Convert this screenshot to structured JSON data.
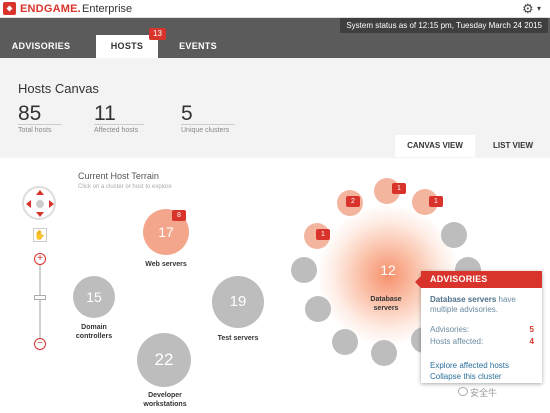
{
  "app": {
    "brand": "ENDGAME.",
    "edition": "Enterprise"
  },
  "status": "System status as of 12:15 pm, Tuesday March 24 2015",
  "tabs": [
    {
      "label": "ADVISORIES"
    },
    {
      "label": "HOSTS",
      "badge": "13"
    },
    {
      "label": "EVENTS"
    }
  ],
  "header": {
    "title": "Hosts Canvas",
    "stats": [
      {
        "value": "85",
        "label": "Total hosts"
      },
      {
        "value": "11",
        "label": "Affected hosts"
      },
      {
        "value": "5",
        "label": "Unique clusters"
      }
    ]
  },
  "views": {
    "canvas": "CANVAS VIEW",
    "list": "LIST VIEW"
  },
  "terrain": {
    "title": "Current Host Terrain",
    "hint": "Click on a cluster or host to explore"
  },
  "clusters": [
    {
      "count": "17",
      "label": "Web servers",
      "badge": "8"
    },
    {
      "count": "15",
      "label": "Domain controllers"
    },
    {
      "count": "19",
      "label": "Test servers"
    },
    {
      "count": "22",
      "label": "Developer workstations"
    },
    {
      "count": "12",
      "label": "Database servers"
    }
  ],
  "host_badges": [
    "1",
    "2",
    "1",
    "1"
  ],
  "tooltip": {
    "title": "ADVISORIES",
    "desc_bold": "Database servers",
    "desc_rest": " have multiple advisories.",
    "advisories_label": "Advisories:",
    "advisories_value": "5",
    "hosts_label": "Hosts affected:",
    "hosts_value": "4",
    "link1": "Explore affected hosts",
    "link2": "Collapse this cluster"
  },
  "watermark": "安全牛",
  "colors": {
    "accent": "#d9342b",
    "nav": "#5b5b5b",
    "cluster_gray": "#bdbdbd",
    "cluster_hot": "#f4a68d"
  }
}
